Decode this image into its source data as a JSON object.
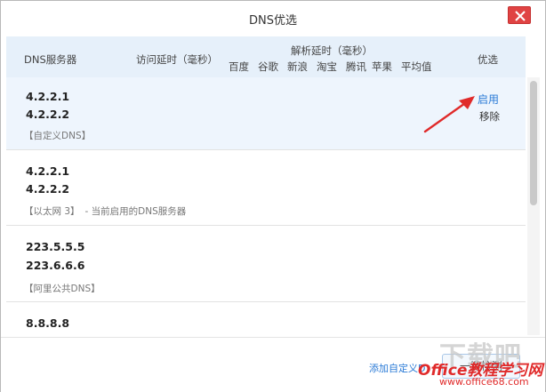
{
  "window": {
    "title": "DNS优选"
  },
  "header": {
    "dns_server": "DNS服务器",
    "visit_latency": "访问延时（毫秒）",
    "parse_latency": "解析延时（毫秒）",
    "sites": [
      "百度",
      "谷歌",
      "新浪",
      "淘宝",
      "腾讯",
      "苹果",
      "平均值"
    ],
    "best": "优选"
  },
  "rows": [
    {
      "ip1": "4.2.2.1",
      "ip2": "4.2.2.2",
      "tag": "【自定义DNS】",
      "desc": "",
      "enable_label": "启用",
      "remove_label": "移除"
    },
    {
      "ip1": "4.2.2.1",
      "ip2": "4.2.2.2",
      "tag": "【以太网 3】",
      "desc": "- 当前启用的DNS服务器"
    },
    {
      "ip1": "223.5.5.5",
      "ip2": "223.6.6.6",
      "tag": "【阿里公共DNS】",
      "desc": ""
    },
    {
      "ip1": "8.8.8.8"
    }
  ],
  "footer": {
    "add_link": "添加自定义D",
    "test_button": "一键检测"
  },
  "watermark": {
    "site_logo": "下载吧",
    "brand": "Office教程学习网",
    "url": "www.office68.com"
  },
  "colors": {
    "header_bg": "#e6f0fa",
    "selected_row_bg": "#eef5fd",
    "link": "#2a7ad6",
    "close": "#e04343",
    "arrow": "#e02a2a"
  }
}
